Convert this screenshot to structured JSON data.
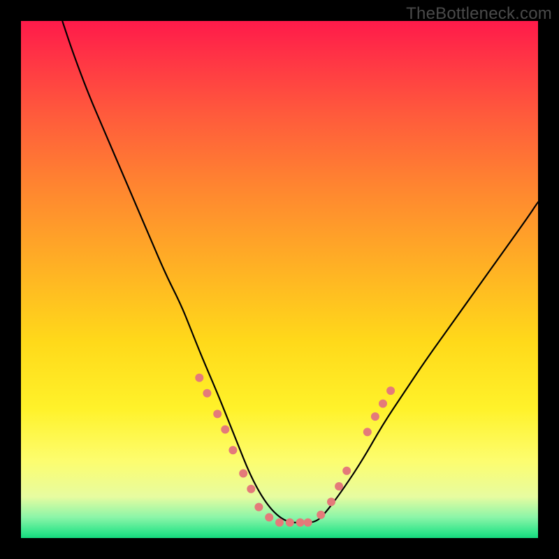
{
  "watermark": "TheBottleneck.com",
  "chart_data": {
    "type": "line",
    "title": "",
    "xlabel": "",
    "ylabel": "",
    "xlim": [
      0,
      100
    ],
    "ylim": [
      0,
      100
    ],
    "series": [
      {
        "name": "curve",
        "x": [
          8,
          10,
          13,
          16,
          19,
          22,
          25,
          28,
          31,
          33,
          35,
          38,
          40,
          42,
          44,
          46,
          48,
          50,
          52,
          54,
          57,
          59,
          62,
          66,
          70,
          74,
          78,
          83,
          88,
          93,
          98,
          100
        ],
        "values": [
          100,
          94,
          86,
          79,
          72,
          65,
          58,
          51,
          45,
          40,
          35,
          28,
          23,
          18,
          13,
          9,
          6,
          4,
          3,
          3,
          3,
          5,
          9,
          15,
          22,
          28,
          34,
          41,
          48,
          55,
          62,
          65
        ]
      }
    ],
    "markers": [
      {
        "x": 34.5,
        "y": 31.0
      },
      {
        "x": 36.0,
        "y": 28.0
      },
      {
        "x": 38.0,
        "y": 24.0
      },
      {
        "x": 39.5,
        "y": 21.0
      },
      {
        "x": 41.0,
        "y": 17.0
      },
      {
        "x": 43.0,
        "y": 12.5
      },
      {
        "x": 44.5,
        "y": 9.5
      },
      {
        "x": 46.0,
        "y": 6.0
      },
      {
        "x": 48.0,
        "y": 4.0
      },
      {
        "x": 50.0,
        "y": 3.0
      },
      {
        "x": 52.0,
        "y": 3.0
      },
      {
        "x": 54.0,
        "y": 3.0
      },
      {
        "x": 55.5,
        "y": 3.0
      },
      {
        "x": 58.0,
        "y": 4.5
      },
      {
        "x": 60.0,
        "y": 7.0
      },
      {
        "x": 61.5,
        "y": 10.0
      },
      {
        "x": 63.0,
        "y": 13.0
      },
      {
        "x": 67.0,
        "y": 20.5
      },
      {
        "x": 68.5,
        "y": 23.5
      },
      {
        "x": 70.0,
        "y": 26.0
      },
      {
        "x": 71.5,
        "y": 28.5
      }
    ],
    "colors": {
      "curve": "#000000",
      "marker": "#e47a7a"
    }
  }
}
